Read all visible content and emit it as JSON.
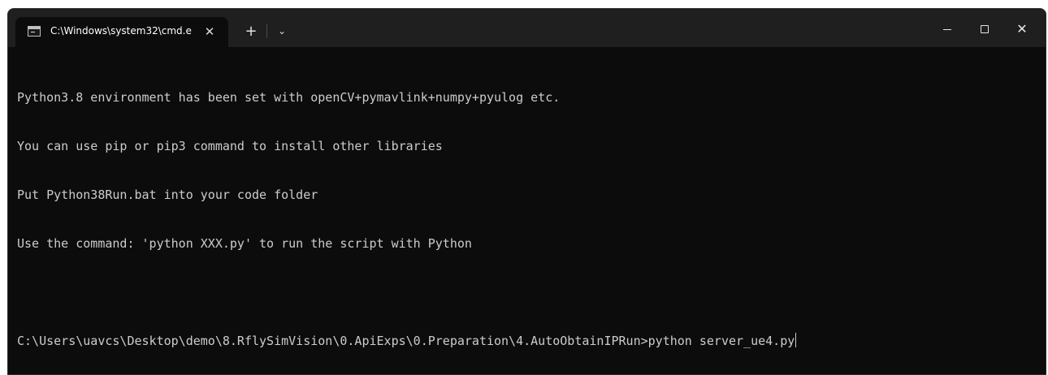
{
  "window": {
    "tab_title": "C:\\Windows\\system32\\cmd.e:",
    "tab_close_label": "✕",
    "new_tab_label": "+",
    "dropdown_label": "⌄",
    "controls": {
      "minimize_label": "",
      "maximize_label": "",
      "close_label": "✕"
    }
  },
  "console": {
    "lines": [
      "Python3.8 environment has been set with openCV+pymavlink+numpy+pyulog etc.",
      "You can use pip or pip3 command to install other libraries",
      "Put Python38Run.bat into your code folder",
      "Use the command: 'python XXX.py' to run the script with Python",
      ""
    ],
    "prompt": "C:\\Users\\uavcs\\Desktop\\demo\\8.RflySimVision\\0.ApiExps\\0.Preparation\\4.AutoObtainIPRun>",
    "command": "python server_ue4.py"
  },
  "colors": {
    "background": "#0c0c0c",
    "titlebar": "#1f1f1f",
    "text": "#cccccc"
  }
}
